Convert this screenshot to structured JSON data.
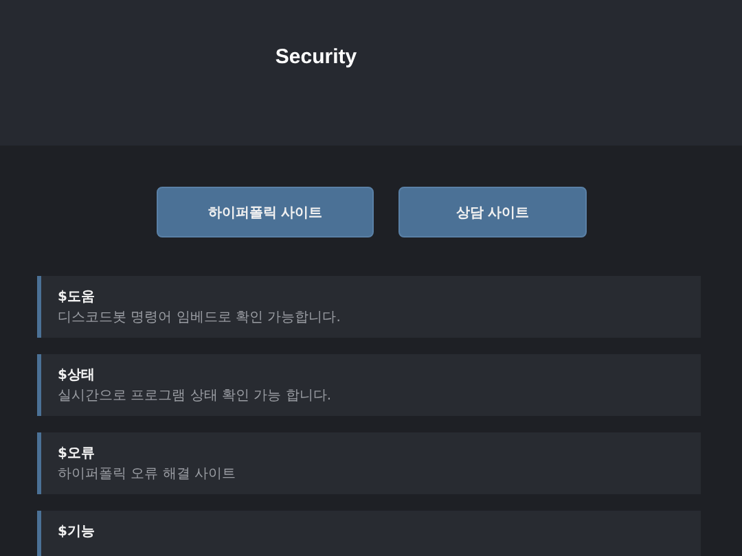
{
  "header": {
    "title": "Security"
  },
  "buttons": [
    "하이퍼폴릭 사이트",
    "상담 사이트"
  ],
  "commands": [
    {
      "name": "$도움",
      "description": "디스코드봇 명령어 임베드로 확인 가능합니다."
    },
    {
      "name": "$상태",
      "description": "실시간으로 프로그램 상태 확인 가능 합니다."
    },
    {
      "name": "$오류",
      "description": "하이퍼폴릭 오류 해결 사이트"
    },
    {
      "name": "$기능"
    }
  ]
}
